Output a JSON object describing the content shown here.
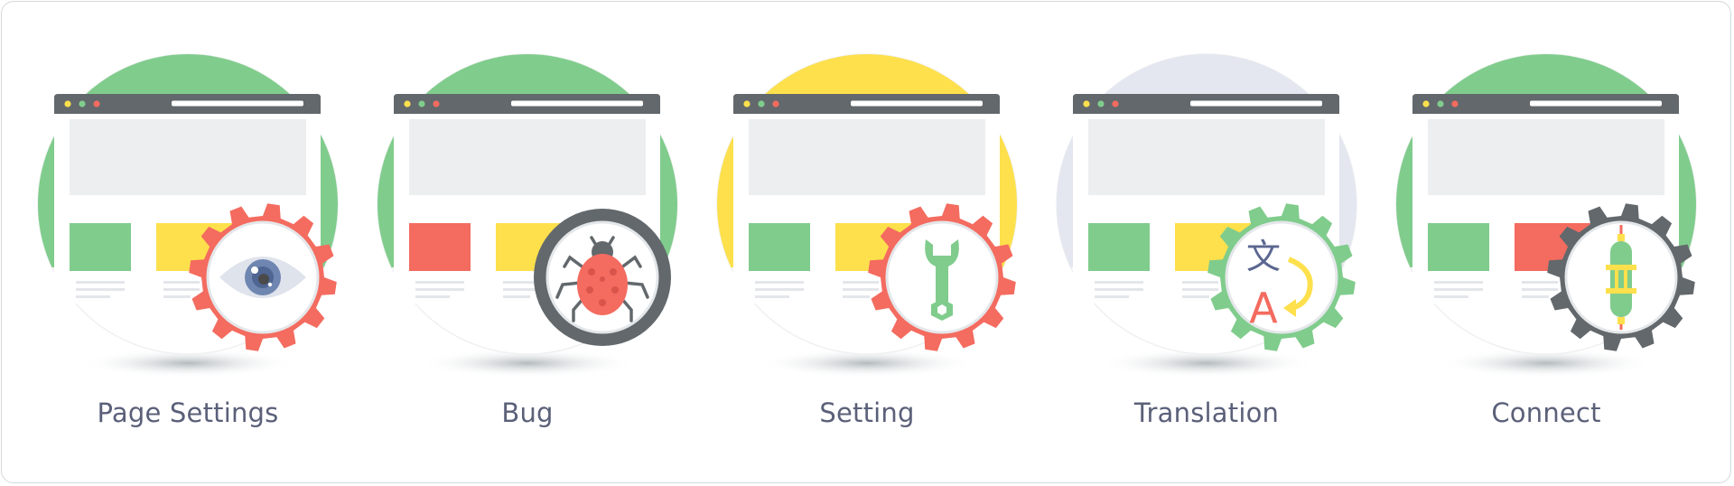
{
  "colors": {
    "green": "#80cc8c",
    "yellow": "#fde04c",
    "red": "#f46b5f",
    "lavender": "#e4e6f0",
    "dark": "#62686c",
    "hero": "#eceeef",
    "label": "#5b6079"
  },
  "panels": [
    {
      "label": "Page Settings",
      "icon": "eye-icon",
      "circle": "green",
      "blocks": [
        "green",
        "yellow"
      ],
      "badge": "gear",
      "badge_color": "red"
    },
    {
      "label": "Bug",
      "icon": "bug-icon",
      "circle": "green",
      "blocks": [
        "red",
        "yellow"
      ],
      "badge": "ring",
      "badge_color": "dark"
    },
    {
      "label": "Setting",
      "icon": "wrench-icon",
      "circle": "yellow",
      "blocks": [
        "green",
        "yellow"
      ],
      "badge": "gear",
      "badge_color": "red"
    },
    {
      "label": "Translation",
      "icon": "translate-icon",
      "circle": "lavender",
      "blocks": [
        "green",
        "yellow"
      ],
      "badge": "gear",
      "badge_color": "green",
      "glyph_top": "文",
      "glyph_bottom": "A"
    },
    {
      "label": "Connect",
      "icon": "plug-icon",
      "circle": "green",
      "blocks": [
        "green",
        "red"
      ],
      "badge": "gear",
      "badge_color": "dark"
    }
  ]
}
